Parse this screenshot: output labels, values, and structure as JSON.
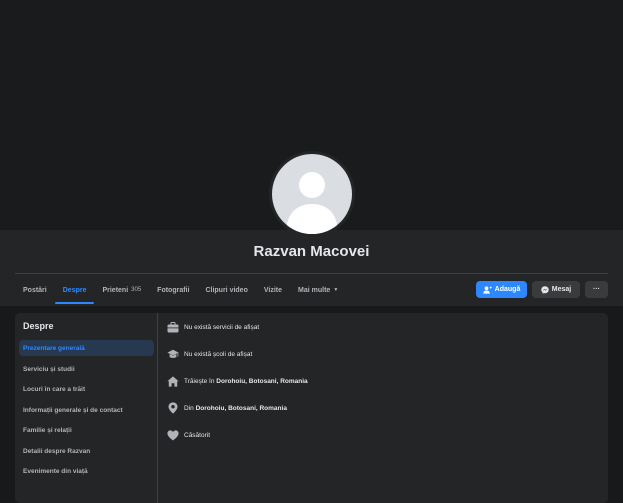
{
  "profile": {
    "name": "Razvan Macovei"
  },
  "tabs": [
    {
      "label": "Postări"
    },
    {
      "label": "Despre"
    },
    {
      "label": "Prieteni",
      "count": "305"
    },
    {
      "label": "Fotografii"
    },
    {
      "label": "Clipuri video"
    },
    {
      "label": "Vizite"
    },
    {
      "label": "Mai multe"
    }
  ],
  "actions": {
    "add_label": "Adaugă",
    "message_label": "Mesaj",
    "more_label": "···"
  },
  "about": {
    "title": "Despre",
    "menu": [
      "Prezentare generală",
      "Serviciu și studii",
      "Locuri în care a trăit",
      "Informații generale și de contact",
      "Familie și relații",
      "Detalii despre Razvan",
      "Evenimente din viață"
    ],
    "rows": {
      "work": "Nu există servicii de afișat",
      "school": "Nu există școli de afișat",
      "lives_prefix": "Trăiește în",
      "lives_place": "Dorohoiu, Botosani, Romania",
      "from_prefix": "Din",
      "from_place": "Dorohoiu, Botosani, Romania",
      "relationship": "Căsătorit"
    }
  },
  "colors": {
    "accent": "#2d88ff",
    "background": "#18191a",
    "card": "#242526"
  },
  "icons": [
    "briefcase-icon",
    "graduation-cap-icon",
    "home-icon",
    "location-pin-icon",
    "heart-icon",
    "add-friend-icon",
    "messenger-icon",
    "chevron-down-icon"
  ]
}
